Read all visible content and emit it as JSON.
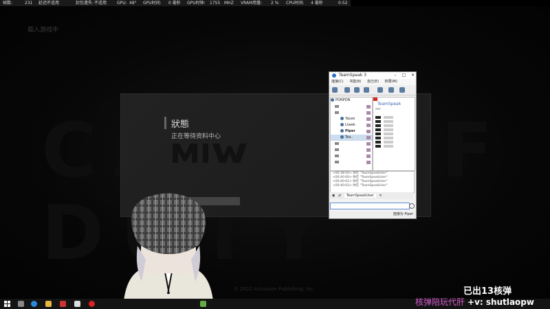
{
  "perf_overlay": {
    "fps_label": "帧数:",
    "fps_value": "231",
    "latency_label": "延迟:",
    "latency_value": "不适用",
    "packet_label": "封包遗失:",
    "packet_value": "不适用",
    "gpu_label": "GPU:",
    "gpu_value": "48°",
    "gpu_time_label": "GPU时间:",
    "gpu_time_value": "0 毫秒",
    "gpu_clock_label": "GPU时钟:",
    "gpu_clock_value": "1755",
    "gpu_clock_unit": "MHZ",
    "vram_label": "VRAM用量:",
    "vram_value": "2 %",
    "cpu_time_label": "CPU时间:",
    "cpu_time_value": "4 毫秒",
    "clock": "0:52"
  },
  "scene": {
    "corner_text": "载入游戏中",
    "background_logo": "CALL OF DUTY",
    "copyright": "© 2022 Activision Publishing, Inc."
  },
  "dialog": {
    "title": "狀態",
    "message": "正在等待资料中心",
    "logo": "MW"
  },
  "teamspeak": {
    "title": "TeamSpeak 3",
    "menu": [
      "连接(C)",
      "书签(B)",
      "自己(E)",
      "权限(M)"
    ],
    "server": "PONPON",
    "tree": [
      {
        "label": "",
        "type": "channel"
      },
      {
        "label": "",
        "type": "channel"
      },
      {
        "label": "YaLee",
        "type": "user"
      },
      {
        "label": "Ltwek",
        "type": "user"
      },
      {
        "label": "Piper",
        "type": "user"
      },
      {
        "label": "Tea..",
        "type": "user"
      },
      {
        "label": "",
        "type": "channel"
      },
      {
        "label": "",
        "type": "channel"
      },
      {
        "label": "",
        "type": "channel"
      },
      {
        "label": "",
        "type": "channel"
      }
    ],
    "info_name": "TeamSpeak",
    "info_sub": "ser",
    "log": [
      "<00:38:00> 你在 \"TeamSpeakUser\"",
      "<00:40:00> 你在 \"TeamSpeakUser\"",
      "<00:40:01> 你在 \"TeamSpeakUser\"",
      "<00:40:02> 你在 \"TeamSpeakUser\""
    ],
    "tab_active": "TeamSpeakUser",
    "status": "连接为 Piper"
  },
  "overlay": {
    "stream_text": "已出13核弹",
    "marquee": "核弹陪玩代肝",
    "marquee_tail": "+v: shutlaopw"
  }
}
